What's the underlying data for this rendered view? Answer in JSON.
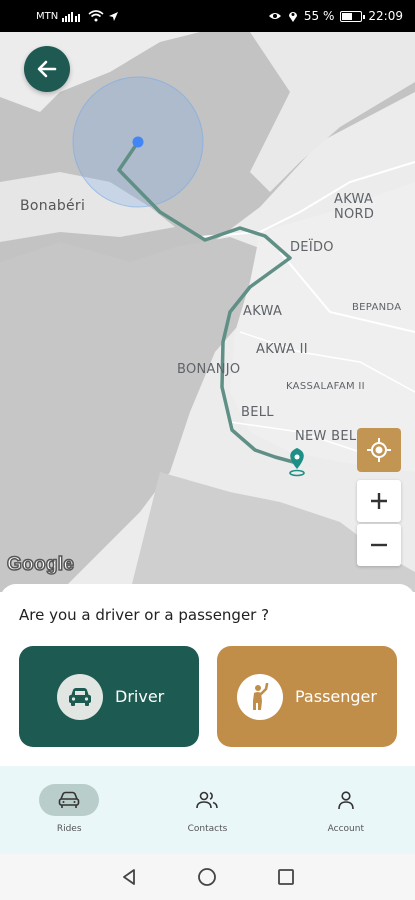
{
  "status_bar": {
    "carrier": "MTN",
    "battery": "55 %",
    "battery_level": 0.55,
    "time": "22:09"
  },
  "map": {
    "labels": {
      "bonaberi": "Bonabéri",
      "akwa_nord": "AKWA NORD",
      "deido": "DEÏDO",
      "bepanda": "BEPANDA",
      "akwa": "AKWA",
      "akwa_ii": "AKWA II",
      "bonanjo": "BONANJO",
      "kassalafam_ii": "KASSALAFAM II",
      "bell": "BELL",
      "new_bell": "NEW BELL"
    },
    "google_logo": "Google",
    "route_color": "#5f8f85",
    "origin_color": "#4285f4",
    "destination_color": "#1d8f86"
  },
  "sheet": {
    "question": "Are you a driver or a passenger ?",
    "driver_label": "Driver",
    "passenger_label": "Passenger",
    "driver_color": "#1d5a51",
    "passenger_color": "#c18e49"
  },
  "nav": {
    "items": [
      {
        "label": "Rides",
        "icon": "car-icon",
        "active": true
      },
      {
        "label": "Contacts",
        "icon": "people-icon",
        "active": false
      },
      {
        "label": "Account",
        "icon": "person-icon",
        "active": false
      }
    ]
  },
  "icons": {
    "back": "arrow-left-icon",
    "locate": "my-location-icon",
    "zoom_in": "plus-icon",
    "zoom_out": "minus-icon"
  }
}
